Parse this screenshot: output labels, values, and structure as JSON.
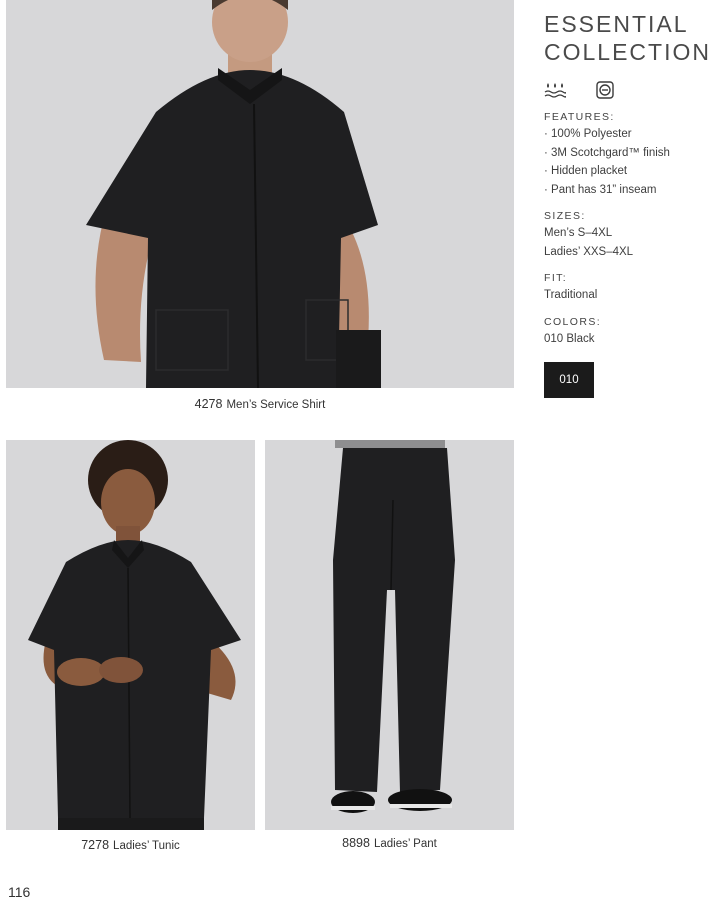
{
  "collection": {
    "title_line1": "ESSENTIAL",
    "title_line2": "COLLECTION",
    "icons": [
      "wash-care-icon",
      "dryer-icon"
    ],
    "features_label": "FEATURES:",
    "features": [
      "100% Polyester",
      "3M Scotchgard™ finish",
      "Hidden placket",
      "Pant has 31” inseam"
    ],
    "sizes_label": "SIZES:",
    "sizes": [
      "Men’s S–4XL",
      "Ladies’ XXS–4XL"
    ],
    "fit_label": "FIT:",
    "fit": "Traditional",
    "colors_label": "COLORS:",
    "colors": "010 Black",
    "swatch": {
      "code": "010",
      "color": "#1b1b1b"
    }
  },
  "products": [
    {
      "code": "4278",
      "name": "Men’s Service Shirt"
    },
    {
      "code": "7278",
      "name": "Ladies’ Tunic"
    },
    {
      "code": "8898",
      "name": "Ladies’ Pant"
    }
  ],
  "page_number": "116"
}
